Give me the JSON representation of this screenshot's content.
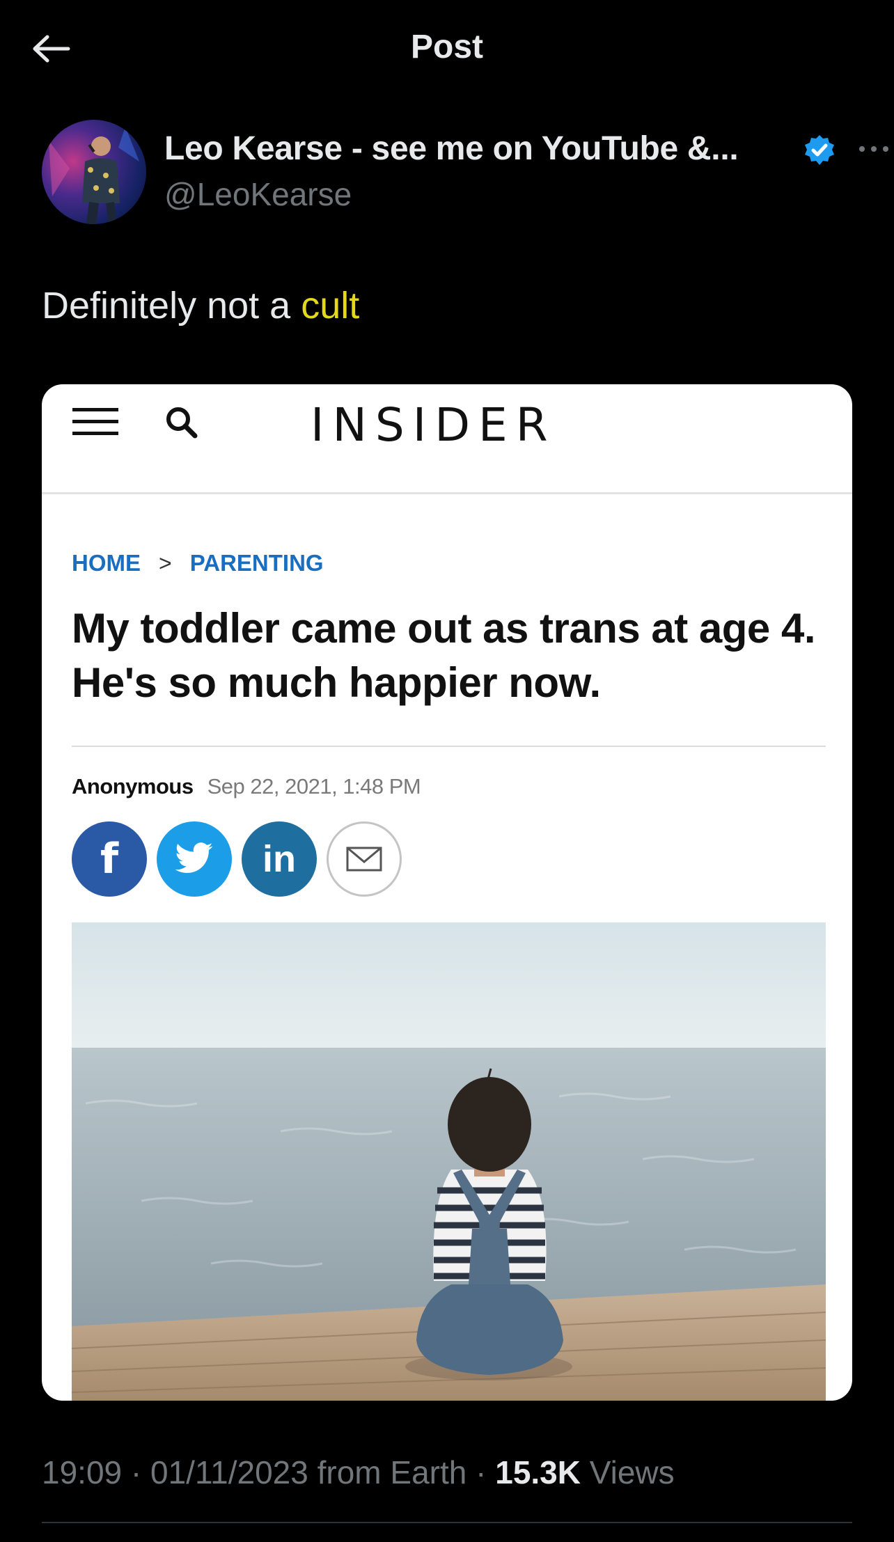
{
  "header": {
    "title": "Post",
    "back_icon": "arrow-left-icon"
  },
  "author": {
    "display_name": "Leo Kearse - see me on YouTube &...",
    "handle": "@LeoKearse",
    "verified_icon": "verified-badge-icon",
    "verified_color": "#1d9bf0",
    "more_icon": "more-horizontal-icon"
  },
  "tweet": {
    "text_prefix": "Definitely not a ",
    "hashtag": "cult",
    "hashtag_color": "#e3d81c"
  },
  "media": {
    "site_logo": "INSIDER",
    "menu_icon": "hamburger-menu-icon",
    "search_icon": "search-icon",
    "breadcrumb": {
      "home": "HOME",
      "separator": ">",
      "section": "PARENTING"
    },
    "headline": "My toddler came out as trans at age 4. He's so much happier now.",
    "byline": {
      "author": "Anonymous",
      "date": "Sep 22, 2021, 1:48 PM"
    },
    "share_buttons": {
      "facebook": "f",
      "twitter_icon": "twitter-bird-icon",
      "linkedin": "in",
      "email_icon": "envelope-icon"
    },
    "photo_icon": "child-on-pier-photo"
  },
  "meta": {
    "time": "19:09",
    "date": "01/11/2023",
    "source": "from Earth",
    "separator": "·",
    "views_count": "15.3K",
    "views_label": "Views"
  }
}
